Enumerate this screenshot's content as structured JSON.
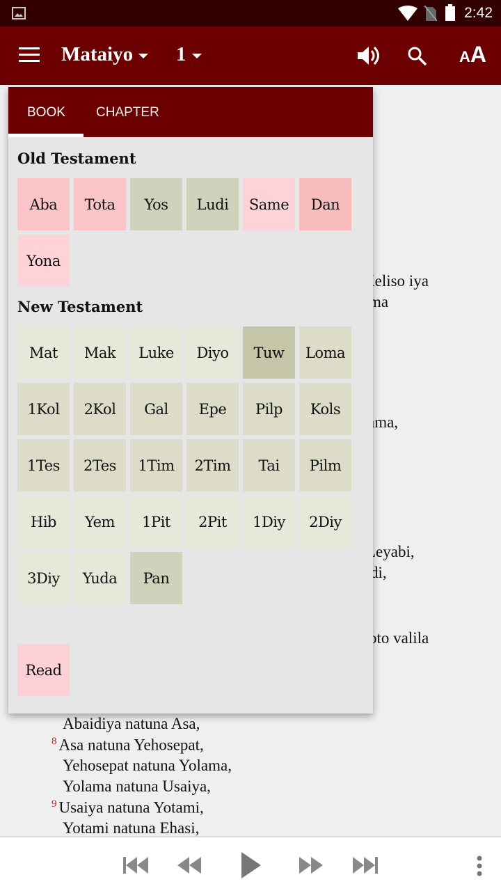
{
  "status": {
    "time": "2:42"
  },
  "appbar": {
    "book": "Mataiyo",
    "chapter": "1"
  },
  "background_text": [
    "Keliso iya",
    "ma",
    "ama,",
    "Leyabi,",
    "di,",
    "oto valila"
  ],
  "verses": [
    {
      "num": "",
      "text": "Abaidiya natuna Asa,"
    },
    {
      "num": "8",
      "text": "Asa natuna Yehosepat,"
    },
    {
      "num": "",
      "text": "Yehosepat natuna Yolama,"
    },
    {
      "num": "",
      "text": "Yolama natuna Usaiya,"
    },
    {
      "num": "9",
      "text": "Usaiya natuna Yotami,"
    },
    {
      "num": "",
      "text": "Yotami natuna Ehasi,"
    }
  ],
  "panel": {
    "tabs": [
      {
        "label": "BOOK",
        "selected": true
      },
      {
        "label": "CHAPTER",
        "selected": false
      }
    ],
    "old_testament_label": "Old Testament",
    "new_testament_label": "New Testament",
    "old_testament": [
      {
        "label": "Aba",
        "color": "#fbc4c8"
      },
      {
        "label": "Tota",
        "color": "#fbc4c8"
      },
      {
        "label": "Yos",
        "color": "#d1d2bb"
      },
      {
        "label": "Ludi",
        "color": "#d1d2bb"
      },
      {
        "label": "Same",
        "color": "#fdd3d8"
      },
      {
        "label": "Dan",
        "color": "#f9bcbd"
      },
      {
        "label": "Yona",
        "color": "#fdd3d8"
      }
    ],
    "new_testament": [
      {
        "label": "Mat",
        "color": "#e7e7da"
      },
      {
        "label": "Mak",
        "color": "#e7e7da"
      },
      {
        "label": "Luke",
        "color": "#e7e7da"
      },
      {
        "label": "Diyo",
        "color": "#e7e7da"
      },
      {
        "label": "Tuw",
        "color": "#c5c5a8"
      },
      {
        "label": "Loma",
        "color": "#dcdcc8"
      },
      {
        "label": "1Kol",
        "color": "#dcdcc8"
      },
      {
        "label": "2Kol",
        "color": "#dcdcc8"
      },
      {
        "label": "Gal",
        "color": "#dcdcc8"
      },
      {
        "label": "Epe",
        "color": "#dcdcc8"
      },
      {
        "label": "Pilp",
        "color": "#dcdcc8"
      },
      {
        "label": "Kols",
        "color": "#dcdcc8"
      },
      {
        "label": "1Tes",
        "color": "#dcdcc8"
      },
      {
        "label": "2Tes",
        "color": "#dcdcc8"
      },
      {
        "label": "1Tim",
        "color": "#dcdcc8"
      },
      {
        "label": "2Tim",
        "color": "#dcdcc8"
      },
      {
        "label": "Tai",
        "color": "#dcdcc8"
      },
      {
        "label": "Pilm",
        "color": "#dcdcc8"
      },
      {
        "label": "Hib",
        "color": "#e7e7da"
      },
      {
        "label": "Yem",
        "color": "#e7e7da"
      },
      {
        "label": "1Pit",
        "color": "#e7e7da"
      },
      {
        "label": "2Pit",
        "color": "#e7e7da"
      },
      {
        "label": "1Diy",
        "color": "#e7e7da"
      },
      {
        "label": "2Diy",
        "color": "#e7e7da"
      },
      {
        "label": "3Diy",
        "color": "#e7e7da"
      },
      {
        "label": "Yuda",
        "color": "#e7e7da"
      },
      {
        "label": "Pan",
        "color": "#d1d2bb"
      }
    ],
    "read": {
      "label": "Read",
      "color": "#fdd0d8"
    }
  },
  "icons": [
    "image-icon",
    "wifi-icon",
    "no-sim-icon",
    "battery-icon",
    "menu-icon",
    "volume-icon",
    "search-icon",
    "text-size-icon",
    "skip-previous-icon",
    "rewind-icon",
    "play-icon",
    "fast-forward-icon",
    "skip-next-icon",
    "more-vert-icon"
  ],
  "colors": {
    "primary": "#6c0000",
    "status_bar": "#330000",
    "verse_number": "#c62828"
  }
}
